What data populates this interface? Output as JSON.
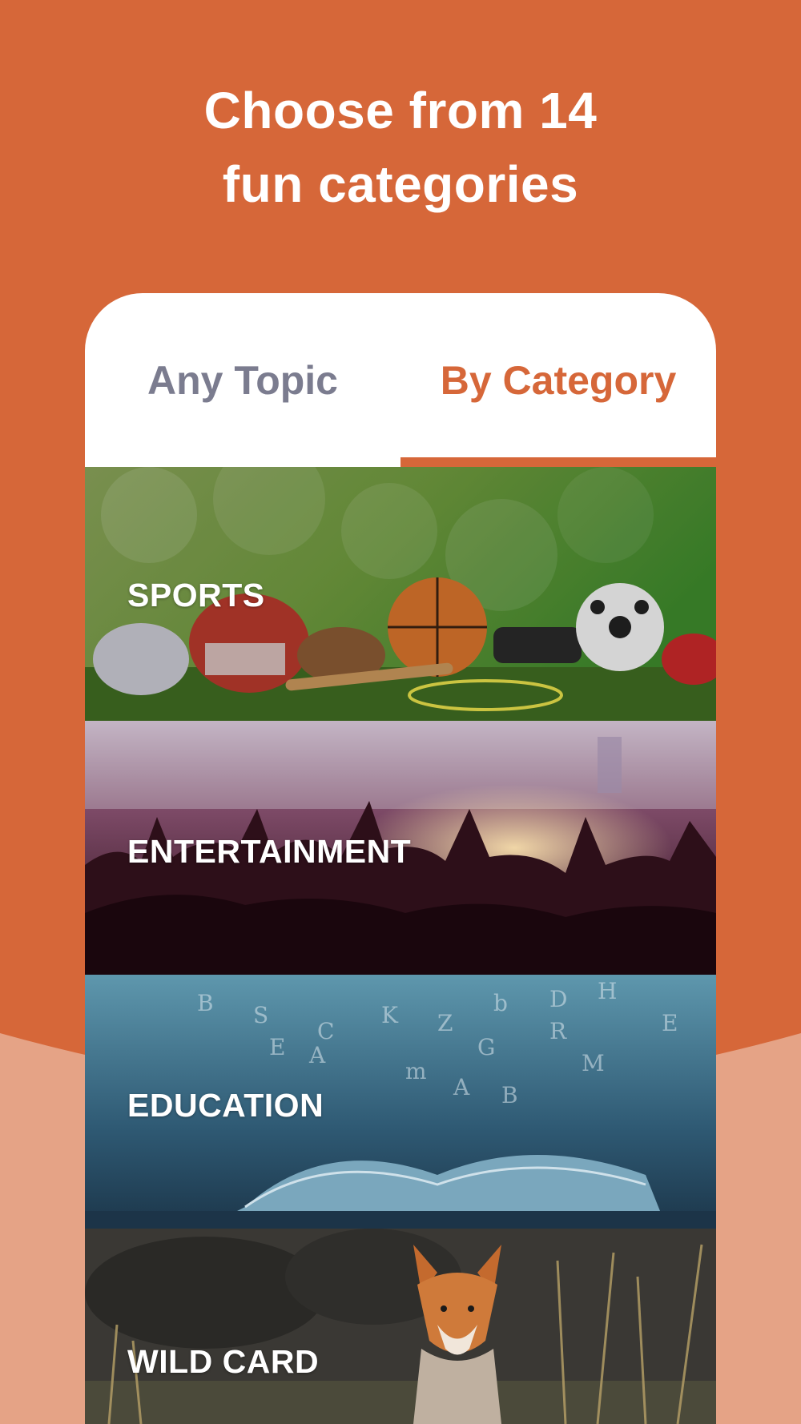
{
  "headline": {
    "line1": "Choose from 14",
    "line2": "fun categories"
  },
  "tabs": [
    {
      "label": "Any Topic",
      "selected": false
    },
    {
      "label": "By Category",
      "selected": true
    }
  ],
  "categories": [
    {
      "label": "SPORTS",
      "image": "sports-equipment-photo"
    },
    {
      "label": "ENTERTAINMENT",
      "image": "concert-crowd-photo"
    },
    {
      "label": "EDUCATION",
      "image": "open-book-letters-photo"
    },
    {
      "label": "WILD CARD",
      "image": "fox-photo"
    }
  ],
  "colors": {
    "background": "#d66739",
    "background_light": "#e5a386",
    "accent": "#d66739",
    "inactive_tab": "#7b7c8f",
    "card": "#ffffff"
  }
}
